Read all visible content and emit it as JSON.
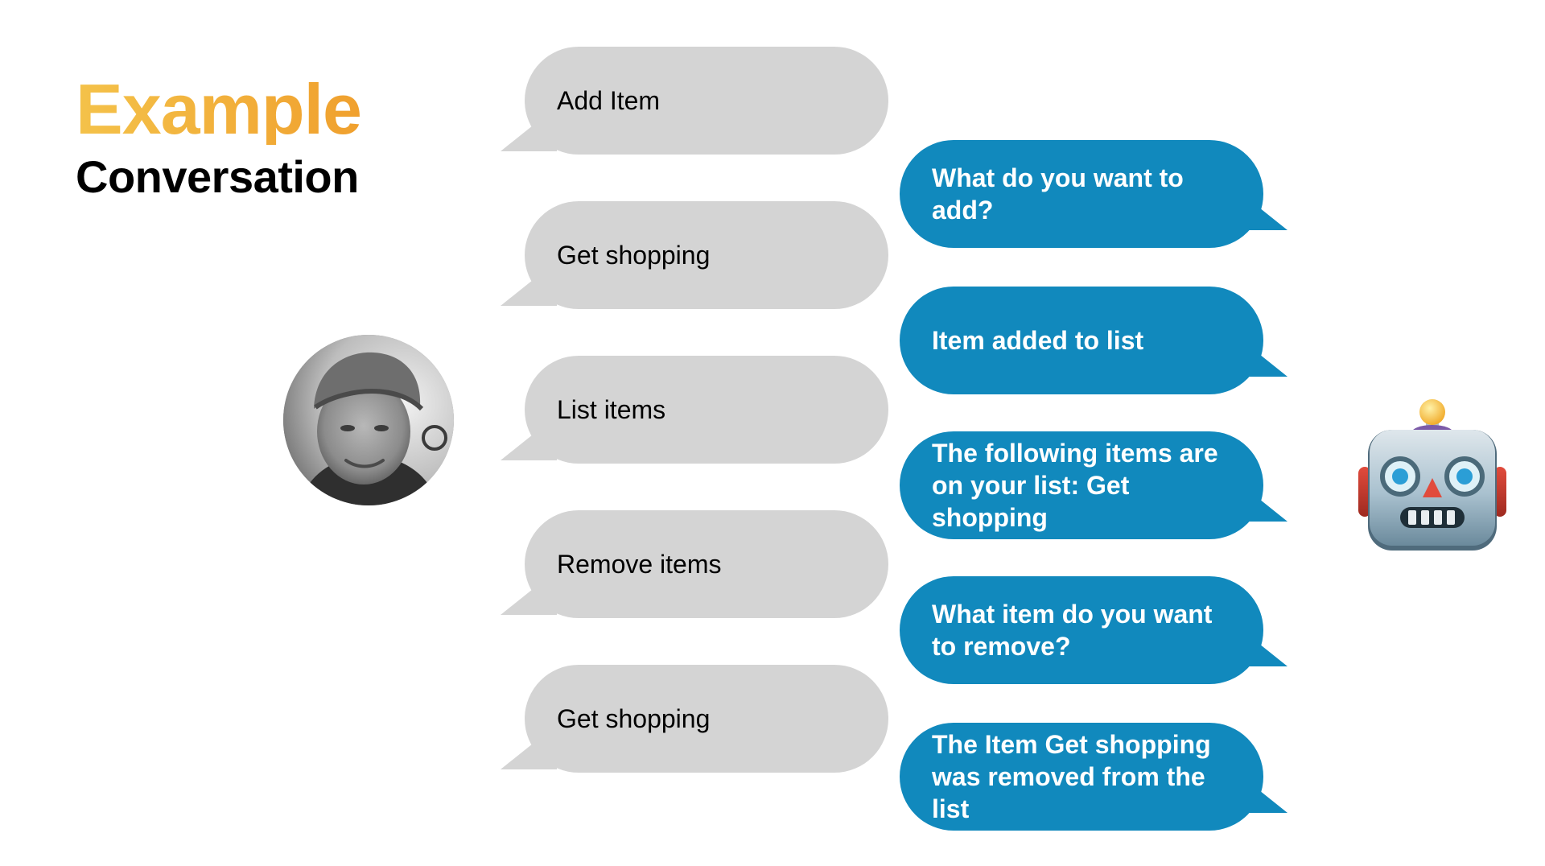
{
  "header": {
    "title": "Example",
    "subtitle": "Conversation"
  },
  "colors": {
    "title_gradient_start": "#f4c24a",
    "title_gradient_end": "#f0a02e",
    "user_bubble": "#d4d4d4",
    "bot_bubble": "#1189bd"
  },
  "participants": {
    "user_avatar_icon": "person-photo-avatar",
    "bot_icon": "robot-face-icon"
  },
  "user_messages": [
    {
      "text": "Add Item"
    },
    {
      "text": "Get shopping"
    },
    {
      "text": "List items"
    },
    {
      "text": "Remove items"
    },
    {
      "text": "Get shopping"
    }
  ],
  "bot_messages": [
    {
      "text": "What do you want to add?"
    },
    {
      "text": "Item added to list"
    },
    {
      "text": "The following items are on your list: Get shopping"
    },
    {
      "text": "What item do you want to remove?"
    },
    {
      "text": "The Item Get shopping was removed from the list"
    }
  ]
}
